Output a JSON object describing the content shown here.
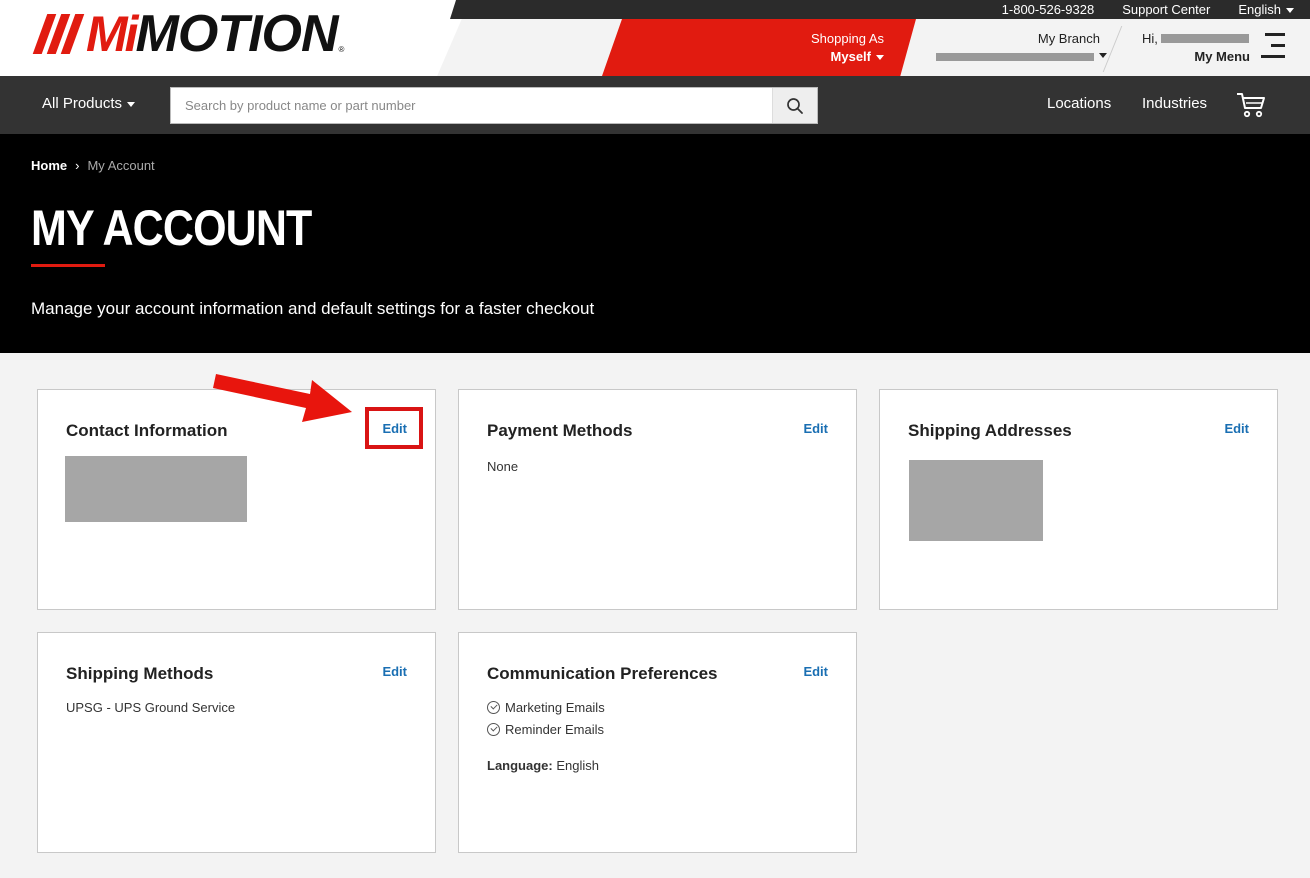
{
  "brand": {
    "logo_prefix": "Mi",
    "logo_text": "MOTION",
    "logo_mark": "®",
    "accent_color": "#e11b10"
  },
  "utility": {
    "phone": "1-800-526-9328",
    "support": "Support Center",
    "language": "English"
  },
  "shopping_as": {
    "label": "Shopping As",
    "value": "Myself"
  },
  "branch": {
    "label": "My Branch"
  },
  "user": {
    "greeting": "Hi,",
    "menu_label": "My Menu"
  },
  "nav": {
    "all_products": "All Products",
    "search_placeholder": "Search by product name or part number",
    "locations": "Locations",
    "industries": "Industries"
  },
  "breadcrumb": {
    "home": "Home",
    "current": "My Account"
  },
  "hero": {
    "title": "MY ACCOUNT",
    "description": "Manage your account information and default settings for a faster checkout"
  },
  "cards": {
    "contact": {
      "title": "Contact Information",
      "edit": "Edit"
    },
    "payment": {
      "title": "Payment Methods",
      "edit": "Edit",
      "value": "None"
    },
    "shipping_addresses": {
      "title": "Shipping Addresses",
      "edit": "Edit"
    },
    "shipping_methods": {
      "title": "Shipping Methods",
      "edit": "Edit",
      "value": "UPSG - UPS Ground Service"
    },
    "communication": {
      "title": "Communication Preferences",
      "edit": "Edit",
      "preferences": [
        "Marketing Emails",
        "Reminder Emails"
      ],
      "language_label": "Language:",
      "language_value": "English"
    }
  },
  "icons": [
    "caret-down-icon",
    "search-icon",
    "cart-icon",
    "hamburger-icon",
    "chevron-right-icon",
    "check-circle-icon",
    "arrow-annotation-icon"
  ]
}
